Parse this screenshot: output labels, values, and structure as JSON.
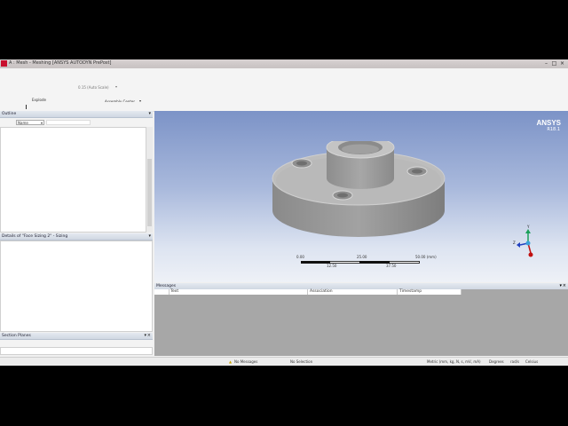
{
  "window": {
    "title": "A : Mesh - Meshing [ANSYS AUTODYN PrePost]"
  },
  "toolbar": {
    "scale_value": "0.15 (Auto Scale)",
    "explode_label": "Explode",
    "assembly_center": "Assembly Center"
  },
  "outline": {
    "title": "Outline",
    "filter_value": "Name"
  },
  "details": {
    "title": "Details of \"Face Sizing 2\" - Sizing"
  },
  "section_planes": {
    "title": "Section Planes"
  },
  "viewport": {
    "brand": "ANSYS",
    "version": "R18.1",
    "scale": {
      "tick_0": "0.00",
      "tick_2": "25.00",
      "tick_4": "50.00 (mm)",
      "tick_1": "12.50",
      "tick_3": "37.50"
    },
    "triad": {
      "x": "X",
      "y": "Y",
      "z": "Z"
    }
  },
  "messages": {
    "title": "Messages",
    "columns": [
      "Text",
      "Association",
      "Timestamp"
    ]
  },
  "status_bar": {
    "messages": "No Messages",
    "selection": "No Selection",
    "units": "Metric (mm, kg, N, s, mV, mA)",
    "angle": "Degrees",
    "angular_velocity": "rad/s",
    "temperature": "Celsius"
  },
  "colors": {
    "accent": "#c8102e",
    "viewport_top": "#7c93c7",
    "viewport_bottom": "#eef1f7"
  }
}
